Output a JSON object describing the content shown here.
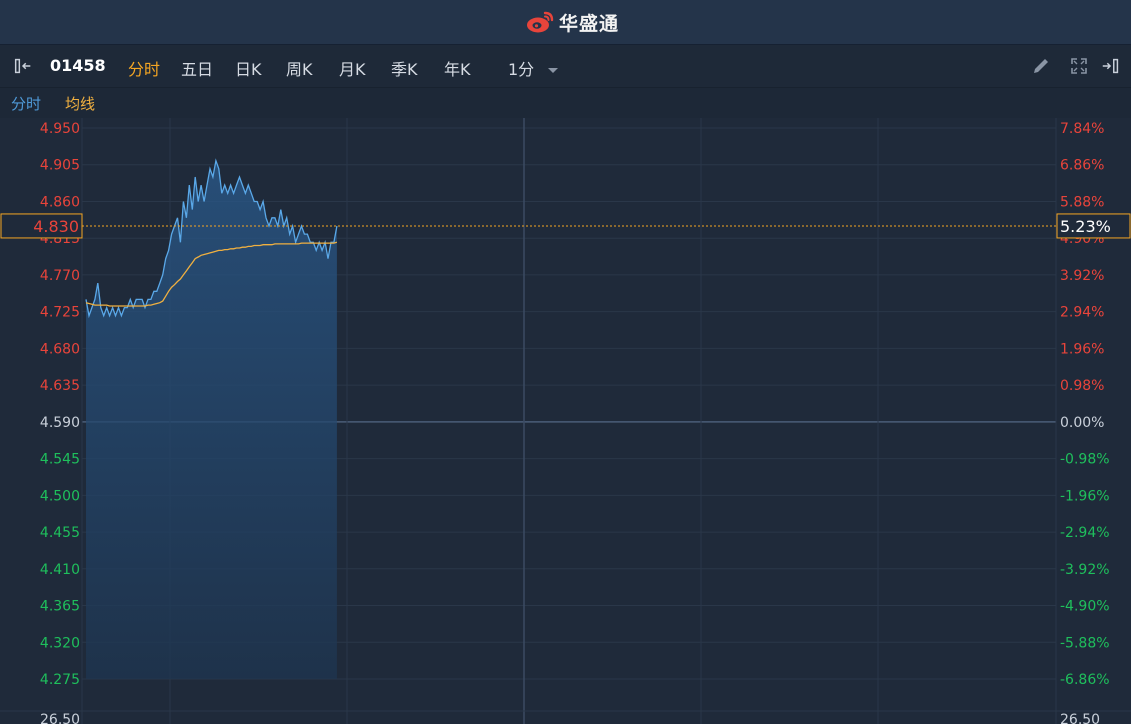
{
  "header": {
    "brand": "华盛通"
  },
  "toolbar": {
    "code": "01458",
    "periods": [
      "分时",
      "五日",
      "日K",
      "周K",
      "月K",
      "季K",
      "年K"
    ],
    "interval": "1分"
  },
  "legend": {
    "price": "分时",
    "avg": "均线"
  },
  "colors": {
    "up": "#e8443b",
    "down": "#1fbf5c",
    "line": "#5aa8e8",
    "avg": "#f0b040",
    "current": "#f5a623"
  },
  "chart_data": {
    "type": "line",
    "prev_close": 4.59,
    "ylim": [
      4.275,
      4.95
    ],
    "y_ticks_left": [
      "4.950",
      "4.905",
      "4.860",
      "4.815",
      "4.770",
      "4.725",
      "4.680",
      "4.635",
      "4.590",
      "4.545",
      "4.500",
      "4.455",
      "4.410",
      "4.365",
      "4.320",
      "4.275"
    ],
    "y_ticks_right": [
      "7.84%",
      "6.86%",
      "5.88%",
      "4.90%",
      "3.92%",
      "2.94%",
      "1.96%",
      "0.98%",
      "0.00%",
      "-0.98%",
      "-1.96%",
      "-2.94%",
      "-3.92%",
      "-4.90%",
      "-5.88%",
      "-6.86%"
    ],
    "current_price": "4.830",
    "current_pct": "5.23%",
    "volume_label": "26.50",
    "minutes_total": 330,
    "series": [
      {
        "name": "分时",
        "values": [
          4.74,
          4.72,
          4.73,
          4.74,
          4.76,
          4.73,
          4.72,
          4.73,
          4.72,
          4.73,
          4.72,
          4.73,
          4.72,
          4.73,
          4.73,
          4.74,
          4.73,
          4.74,
          4.74,
          4.74,
          4.73,
          4.74,
          4.74,
          4.75,
          4.75,
          4.76,
          4.77,
          4.79,
          4.8,
          4.82,
          4.83,
          4.84,
          4.81,
          4.86,
          4.84,
          4.88,
          4.85,
          4.89,
          4.86,
          4.88,
          4.86,
          4.88,
          4.9,
          4.89,
          4.91,
          4.9,
          4.87,
          4.88,
          4.87,
          4.88,
          4.87,
          4.88,
          4.89,
          4.88,
          4.87,
          4.88,
          4.87,
          4.86,
          4.86,
          4.85,
          4.86,
          4.84,
          4.83,
          4.84,
          4.84,
          4.83,
          4.85,
          4.83,
          4.84,
          4.82,
          4.83,
          4.81,
          4.82,
          4.83,
          4.82,
          4.82,
          4.81,
          4.81,
          4.8,
          4.81,
          4.8,
          4.81,
          4.79,
          4.81,
          4.81,
          4.83
        ]
      },
      {
        "name": "均线",
        "values": [
          4.736,
          4.735,
          4.734,
          4.733,
          4.733,
          4.733,
          4.733,
          4.733,
          4.732,
          4.732,
          4.732,
          4.732,
          4.732,
          4.732,
          4.732,
          4.732,
          4.732,
          4.732,
          4.732,
          4.732,
          4.732,
          4.733,
          4.733,
          4.734,
          4.735,
          4.736,
          4.738,
          4.744,
          4.75,
          4.755,
          4.758,
          4.762,
          4.765,
          4.77,
          4.775,
          4.78,
          4.785,
          4.79,
          4.792,
          4.794,
          4.795,
          4.796,
          4.797,
          4.798,
          4.799,
          4.8,
          4.8,
          4.801,
          4.801,
          4.802,
          4.802,
          4.803,
          4.803,
          4.804,
          4.804,
          4.805,
          4.805,
          4.806,
          4.806,
          4.806,
          4.807,
          4.807,
          4.807,
          4.807,
          4.808,
          4.808,
          4.808,
          4.808,
          4.808,
          4.808,
          4.808,
          4.808,
          4.808,
          4.809,
          4.809,
          4.809,
          4.809,
          4.809,
          4.809,
          4.809,
          4.809,
          4.809,
          4.809,
          4.809,
          4.809,
          4.81
        ]
      }
    ]
  }
}
